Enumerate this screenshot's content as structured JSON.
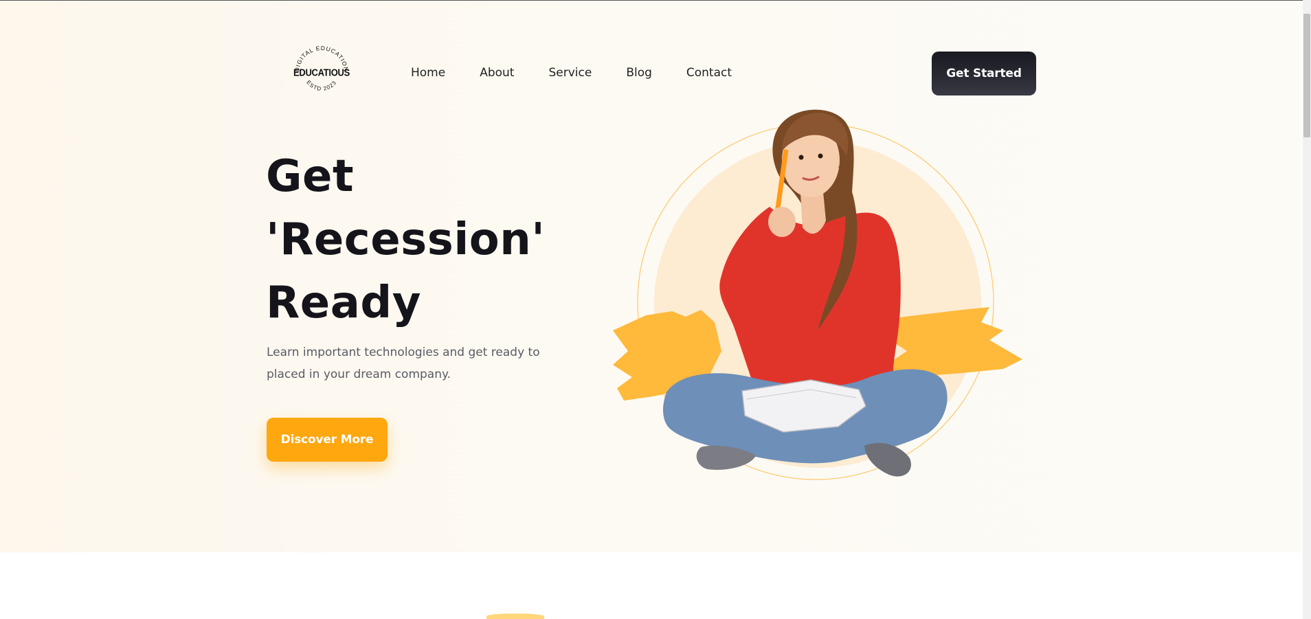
{
  "logo": {
    "top_arc_text": "DIGITAL EDUCATION",
    "name": "EDUCATIOUS",
    "bottom_arc_text": "ESTD 2023"
  },
  "nav": {
    "items": [
      {
        "label": "Home"
      },
      {
        "label": "About"
      },
      {
        "label": "Service"
      },
      {
        "label": "Blog"
      },
      {
        "label": "Contact"
      }
    ],
    "cta_label": "Get Started"
  },
  "hero": {
    "headline_lines": [
      "Get",
      "'Recession'",
      "Ready"
    ],
    "subtext": "Learn important technologies and get ready to placed in your dream company.",
    "cta_label": "Discover More",
    "illustration_icon": "student-with-notebook-illustration"
  },
  "colors": {
    "accent": "#ffa70f",
    "dark_button": "#1a1a22",
    "headline": "#14141a",
    "subtext": "#5a5a66",
    "hero_background": "#fdf8ee",
    "circle_fill": "#fdebd2",
    "brush_stroke": "#ffb93b"
  }
}
